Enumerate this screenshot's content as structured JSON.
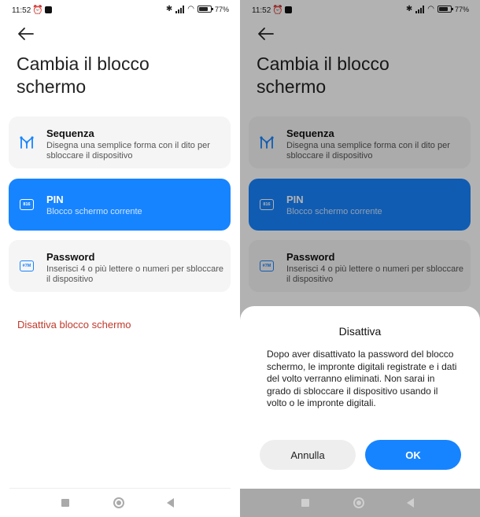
{
  "status": {
    "time": "11:52",
    "battery": "77",
    "battery_level": 0.77
  },
  "screen": {
    "title": "Cambia il blocco schermo",
    "options": [
      {
        "title": "Sequenza",
        "desc": "Disegna una semplice forma con il dito per sbloccare il dispositivo",
        "icon": "pattern-icon"
      },
      {
        "title": "PIN",
        "desc": "Blocco schermo corrente",
        "icon": "pin-icon",
        "icon_text": "816"
      },
      {
        "title": "Password",
        "desc": "Inserisci 4 o più lettere o numeri per sbloccare il dispositivo",
        "icon": "password-icon",
        "icon_text": "#7M"
      }
    ],
    "disable_label": "Disattiva blocco schermo"
  },
  "dialog": {
    "title": "Disattiva",
    "body": "Dopo aver disattivato la password del blocco schermo, le impronte digitali registrate e i dati del volto verranno eliminati. Non sarai in grado di sbloccare il dispositivo usando il volto o le impronte digitali.",
    "cancel_label": "Annulla",
    "ok_label": "OK"
  },
  "colors": {
    "accent": "#1784ff",
    "danger": "#c0392b",
    "card": "#f5f5f5"
  }
}
